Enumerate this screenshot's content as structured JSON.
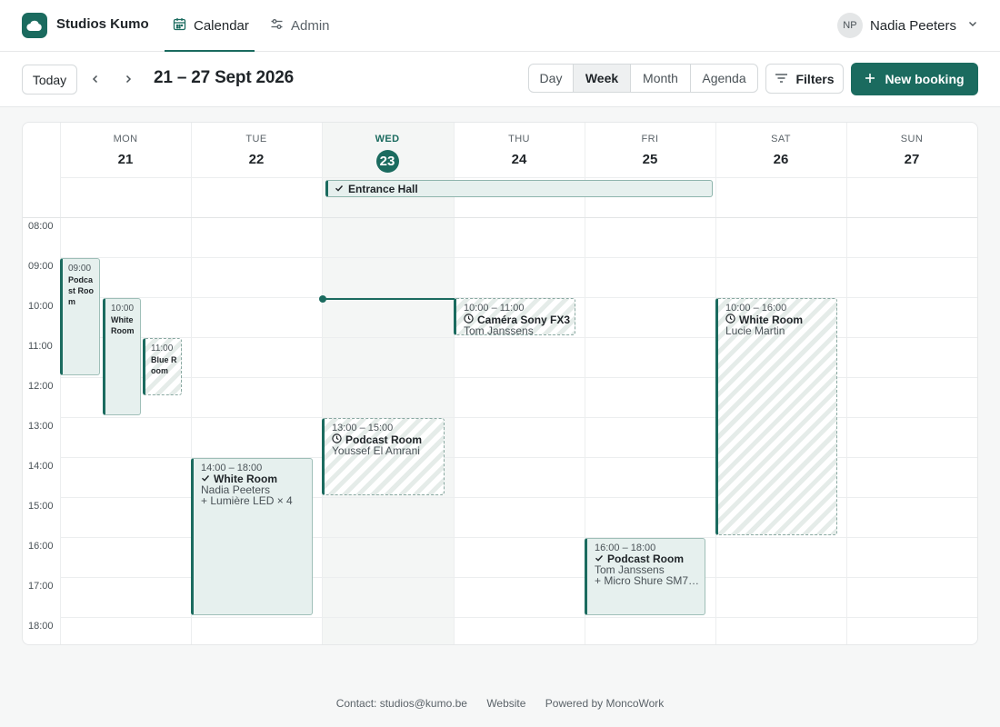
{
  "brand": {
    "name": "Studios Kumo",
    "logo_icon": "cloud-icon",
    "accent": "#1b6b5f"
  },
  "nav": {
    "tabs": [
      {
        "label": "Calendar",
        "icon": "calendar-icon",
        "active": true
      },
      {
        "label": "Admin",
        "icon": "sliders-icon",
        "active": false
      }
    ]
  },
  "user": {
    "initials": "NP",
    "name": "Nadia Peeters"
  },
  "toolbar": {
    "today_label": "Today",
    "range_title": "21 – 27 Sept 2026",
    "views": [
      "Day",
      "Week",
      "Month",
      "Agenda"
    ],
    "active_view": "Week",
    "filters_label": "Filters",
    "new_booking_label": "New booking"
  },
  "week": {
    "days": [
      {
        "name": "MON",
        "num": "21"
      },
      {
        "name": "TUE",
        "num": "22"
      },
      {
        "name": "WED",
        "num": "23",
        "today": true
      },
      {
        "name": "THU",
        "num": "24"
      },
      {
        "name": "FRI",
        "num": "25"
      },
      {
        "name": "SAT",
        "num": "26"
      },
      {
        "name": "SUN",
        "num": "27"
      }
    ],
    "hours": [
      "08:00",
      "09:00",
      "10:00",
      "11:00",
      "12:00",
      "13:00",
      "14:00",
      "15:00",
      "16:00",
      "17:00",
      "18:00"
    ],
    "all_day": {
      "resource": "Entrance Hall",
      "status": "confirmed",
      "from_day": "WED",
      "to_day": "FRI"
    }
  },
  "events": {
    "mon_podcast": {
      "time": "09:00",
      "resource": "Podcast Room",
      "status": "confirmed"
    },
    "mon_white": {
      "time": "10:00",
      "resource": "White Room",
      "status": "confirmed"
    },
    "mon_blue": {
      "time": "11:00",
      "resource": "Blue Room",
      "status": "pending"
    },
    "tue_white": {
      "time": "14:00 – 18:00",
      "resource": "White Room",
      "person": "Nadia Peeters",
      "extra": "+ Lumière LED × 4",
      "status": "confirmed"
    },
    "wed_podcast": {
      "time": "13:00 – 15:00",
      "resource": "Podcast Room",
      "person": "Youssef El Amrani",
      "status": "pending"
    },
    "thu_camera": {
      "time": "10:00 – 11:00",
      "resource": "Caméra Sony FX3",
      "person": "Tom Janssens",
      "status": "pending"
    },
    "fri_podcast": {
      "time": "16:00 – 18:00",
      "resource": "Podcast Room",
      "person": "Tom Janssens",
      "extra": "+ Micro Shure SM7B…",
      "status": "confirmed"
    },
    "sat_white": {
      "time": "10:00 – 16:00",
      "resource": "White Room",
      "person": "Lucie Martin",
      "status": "pending"
    }
  },
  "footer": {
    "contact": "Contact: studios@kumo.be",
    "website": "Website",
    "powered": "Powered by MoncoWork"
  }
}
